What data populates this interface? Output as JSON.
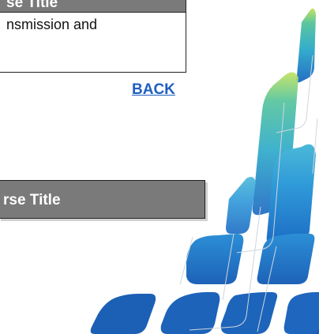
{
  "course_box_1": {
    "header_text": "se Title",
    "body_text": "nsmission and"
  },
  "back_link": {
    "label": "BACK"
  },
  "course_box_2": {
    "header_text": "rse Title"
  },
  "colors": {
    "header_bg": "#7a7a7a",
    "link": "#1f5fbf",
    "deco_blue": "#1f6fc4",
    "deco_teal": "#2bb3a6",
    "deco_green": "#9ccc3b"
  }
}
